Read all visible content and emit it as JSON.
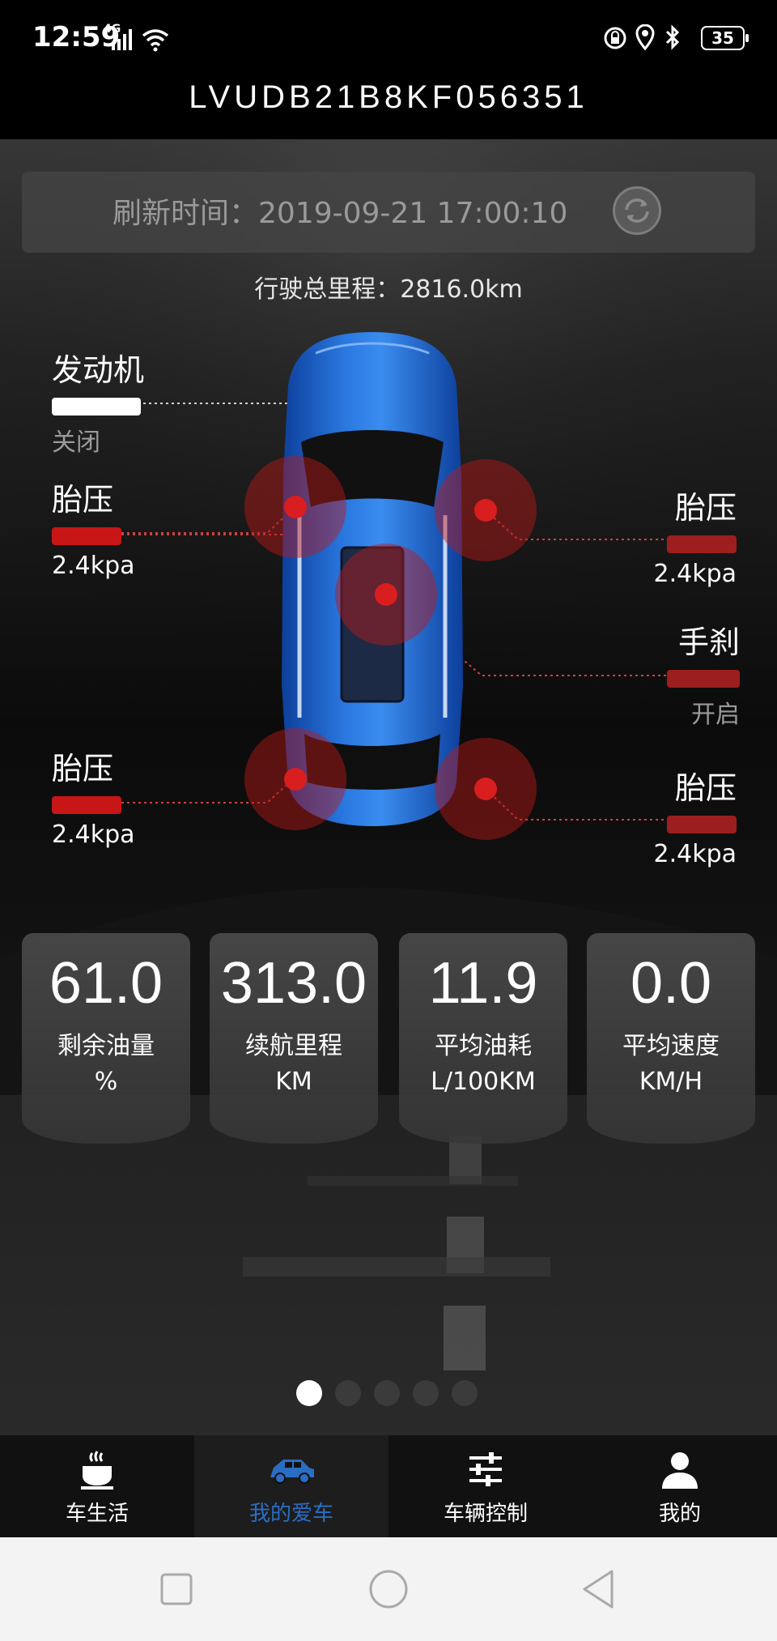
{
  "status_bar": {
    "time": "12:59",
    "network": "4G",
    "left_icons": [
      "signal-icon",
      "wifi-icon"
    ],
    "right_icons": [
      "lock-icon",
      "location-icon",
      "bluetooth-icon",
      "battery-icon"
    ],
    "battery": "35"
  },
  "header": {
    "vin": "LVUDB21B8KF056351"
  },
  "refresh": {
    "label": "刷新时间：",
    "value": "2019-09-21 17:00:10",
    "icon": "refresh-icon"
  },
  "mileage": "行驶总里程：2816.0km",
  "vehicle": {
    "engine": {
      "title": "发动机",
      "status": "关闭"
    },
    "tire_front_left": {
      "title": "胎压",
      "value": "2.4kpa"
    },
    "tire_front_right": {
      "title": "胎压",
      "value": "2.4kpa"
    },
    "tire_rear_left": {
      "title": "胎压",
      "value": "2.4kpa"
    },
    "tire_rear_right": {
      "title": "胎压",
      "value": "2.4kpa"
    },
    "handbrake": {
      "title": "手刹",
      "status": "开启"
    }
  },
  "stats": [
    {
      "value": "61.0",
      "label": "剩余油量",
      "unit": "%"
    },
    {
      "value": "313.0",
      "label": "续航里程",
      "unit": "KM"
    },
    {
      "value": "11.9",
      "label": "平均油耗",
      "unit": "L/100KM"
    },
    {
      "value": "0.0",
      "label": "平均速度",
      "unit": "KM/H"
    }
  ],
  "pager": {
    "count": 5,
    "active": 1
  },
  "bottom_nav": [
    {
      "label": "车生活",
      "icon": "coffee-cup-icon",
      "active": false
    },
    {
      "label": "我的爱车",
      "icon": "car-icon",
      "active": true
    },
    {
      "label": "车辆控制",
      "icon": "sliders-icon",
      "active": false
    },
    {
      "label": "我的",
      "icon": "user-icon",
      "active": false
    }
  ],
  "colors": {
    "accent_blue": "#2a6ec4",
    "alert_red": "#c81616",
    "car_blue": "#1f63c9"
  }
}
